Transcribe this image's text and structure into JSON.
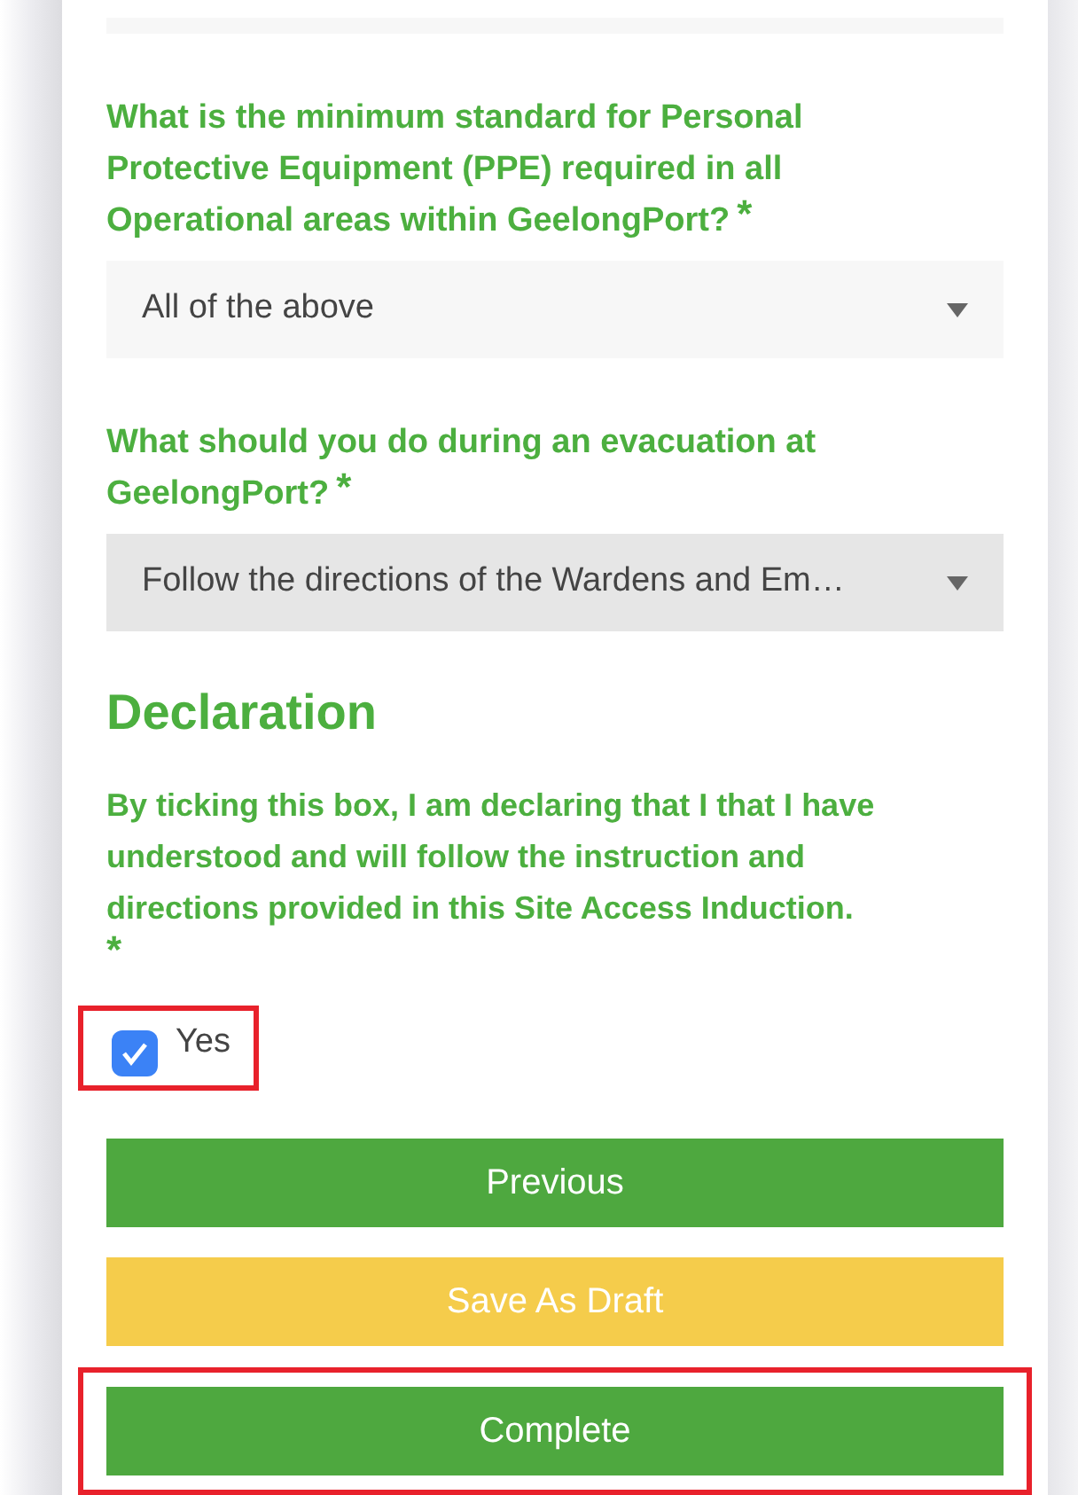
{
  "questions": [
    {
      "label": "What is the minimum standard for Personal Protective Equipment (PPE) required in all Operational areas within  GeelongPort?",
      "required_mark": "*",
      "answer": "All of the above",
      "focused": false
    },
    {
      "label": "What should you do during an evacuation at GeelongPort?",
      "required_mark": "*",
      "answer": "Follow the directions of the Wardens and Em…",
      "focused": true
    }
  ],
  "declaration": {
    "heading": "Declaration",
    "text": "By ticking this box, I am declaring that I that I have understood and will follow the instruction and directions provided in this Site Access Induction.",
    "required_mark": "*",
    "option": {
      "label": "Yes",
      "checked": true,
      "highlighted": true
    }
  },
  "buttons": [
    {
      "label": "Previous",
      "kind": "primary",
      "highlighted": false
    },
    {
      "label": "Save As Draft",
      "kind": "draft",
      "highlighted": false
    },
    {
      "label": "Complete",
      "kind": "primary",
      "highlighted": true
    }
  ]
}
